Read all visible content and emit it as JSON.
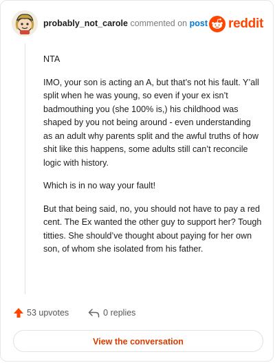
{
  "header": {
    "username": "probably_not_carole",
    "action_text": "commented on",
    "post_link": "post",
    "brand": "reddit"
  },
  "comment": {
    "paragraphs": [
      "NTA",
      "IMO, your son is acting an A, but that’s not his fault. Y’all split when he was young, so even if your ex isn’t badmouthing you (she 100% is,) his childhood was shaped by you not being around - even understanding as an adult why parents split and the awful truths of how shit like this happens, some adults still can’t reconcile logic with history.",
      "Which is in no way your fault!",
      "But that being said, no, you should not have to pay a red cent. The Ex wanted the other guy to support her? Tough titties. She should’ve thought about paying for her own son, of whom she isolated from his father."
    ]
  },
  "footer": {
    "upvotes": "53 upvotes",
    "replies": "0 replies",
    "view_button": "View the conversation"
  },
  "colors": {
    "brand": "#ff4500",
    "link": "#0079d3",
    "button_text": "#d93a00"
  },
  "icons": {
    "avatar": "snoo-avatar-icon",
    "logo": "reddit-logo-icon",
    "upvote": "upvote-arrow-icon",
    "reply": "reply-arrow-icon"
  }
}
